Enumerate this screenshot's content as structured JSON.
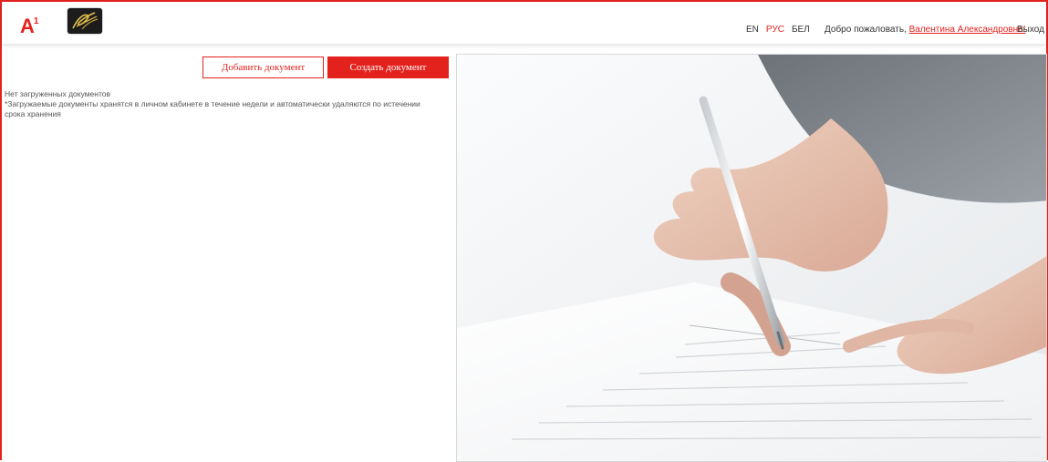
{
  "header": {
    "logo_text": "A",
    "logo_sup": "1",
    "languages": [
      {
        "label": "EN",
        "active": false
      },
      {
        "label": "РУС",
        "active": true
      },
      {
        "label": "БЕЛ",
        "active": false
      }
    ],
    "welcome_prefix": "Добро пожаловать,",
    "user_name": "Валентина Александровна!",
    "logout_label": "Выход"
  },
  "actions": {
    "add_document_label": "Добавить документ",
    "create_document_label": "Создать документ"
  },
  "documents": {
    "empty_text": "Нет загруженных документов",
    "note_text": "*Загружаемые документы хранятся в личном кабинете в течение недели и автоматически удаляются по истечении срока хранения"
  },
  "colors": {
    "accent": "#e3221d",
    "text": "#444444"
  }
}
